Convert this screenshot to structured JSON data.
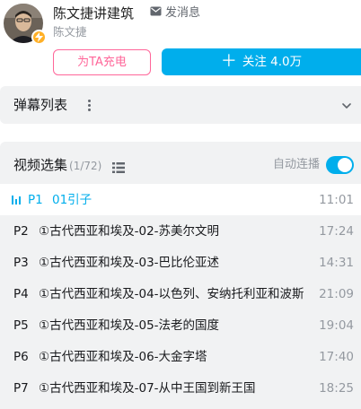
{
  "uploader": {
    "name": "陈文捷讲建筑",
    "message_label": "发消息",
    "description": "陈文捷",
    "charge_label": "为TA充电",
    "follow_label": "关注 4.0万"
  },
  "danmaku": {
    "title": "弹幕列表"
  },
  "playlist": {
    "title": "视频选集",
    "count": "(1/72)",
    "autoplay_label": "自动连播",
    "autoplay_on": true,
    "episodes": [
      {
        "no": "P1",
        "title": "01引子",
        "duration": "11:01",
        "active": true
      },
      {
        "no": "P2",
        "title": "①古代西亚和埃及-02-苏美尔文明",
        "duration": "17:24"
      },
      {
        "no": "P3",
        "title": "①古代西亚和埃及-03-巴比伦亚述",
        "duration": "14:31"
      },
      {
        "no": "P4",
        "title": "①古代西亚和埃及-04-以色列、安纳托利亚和波斯",
        "duration": "21:09"
      },
      {
        "no": "P5",
        "title": "①古代西亚和埃及-05-法老的国度",
        "duration": "19:04"
      },
      {
        "no": "P6",
        "title": "①古代西亚和埃及-06-大金字塔",
        "duration": "17:40"
      },
      {
        "no": "P7",
        "title": "①古代西亚和埃及-07-从中王国到新王国",
        "duration": "18:25"
      }
    ]
  },
  "colors": {
    "accent": "#00aeec",
    "pink": "#ff6699",
    "panel_bg": "#f1f2f3",
    "muted_text": "#9499a0"
  },
  "icons": {
    "message": "envelope-icon",
    "danmaku_more": "kebab-icon",
    "danmaku_expand": "chevron-down-icon",
    "list_view": "list-icon",
    "playing": "playing-bars-icon",
    "badge": "lightning-icon"
  }
}
